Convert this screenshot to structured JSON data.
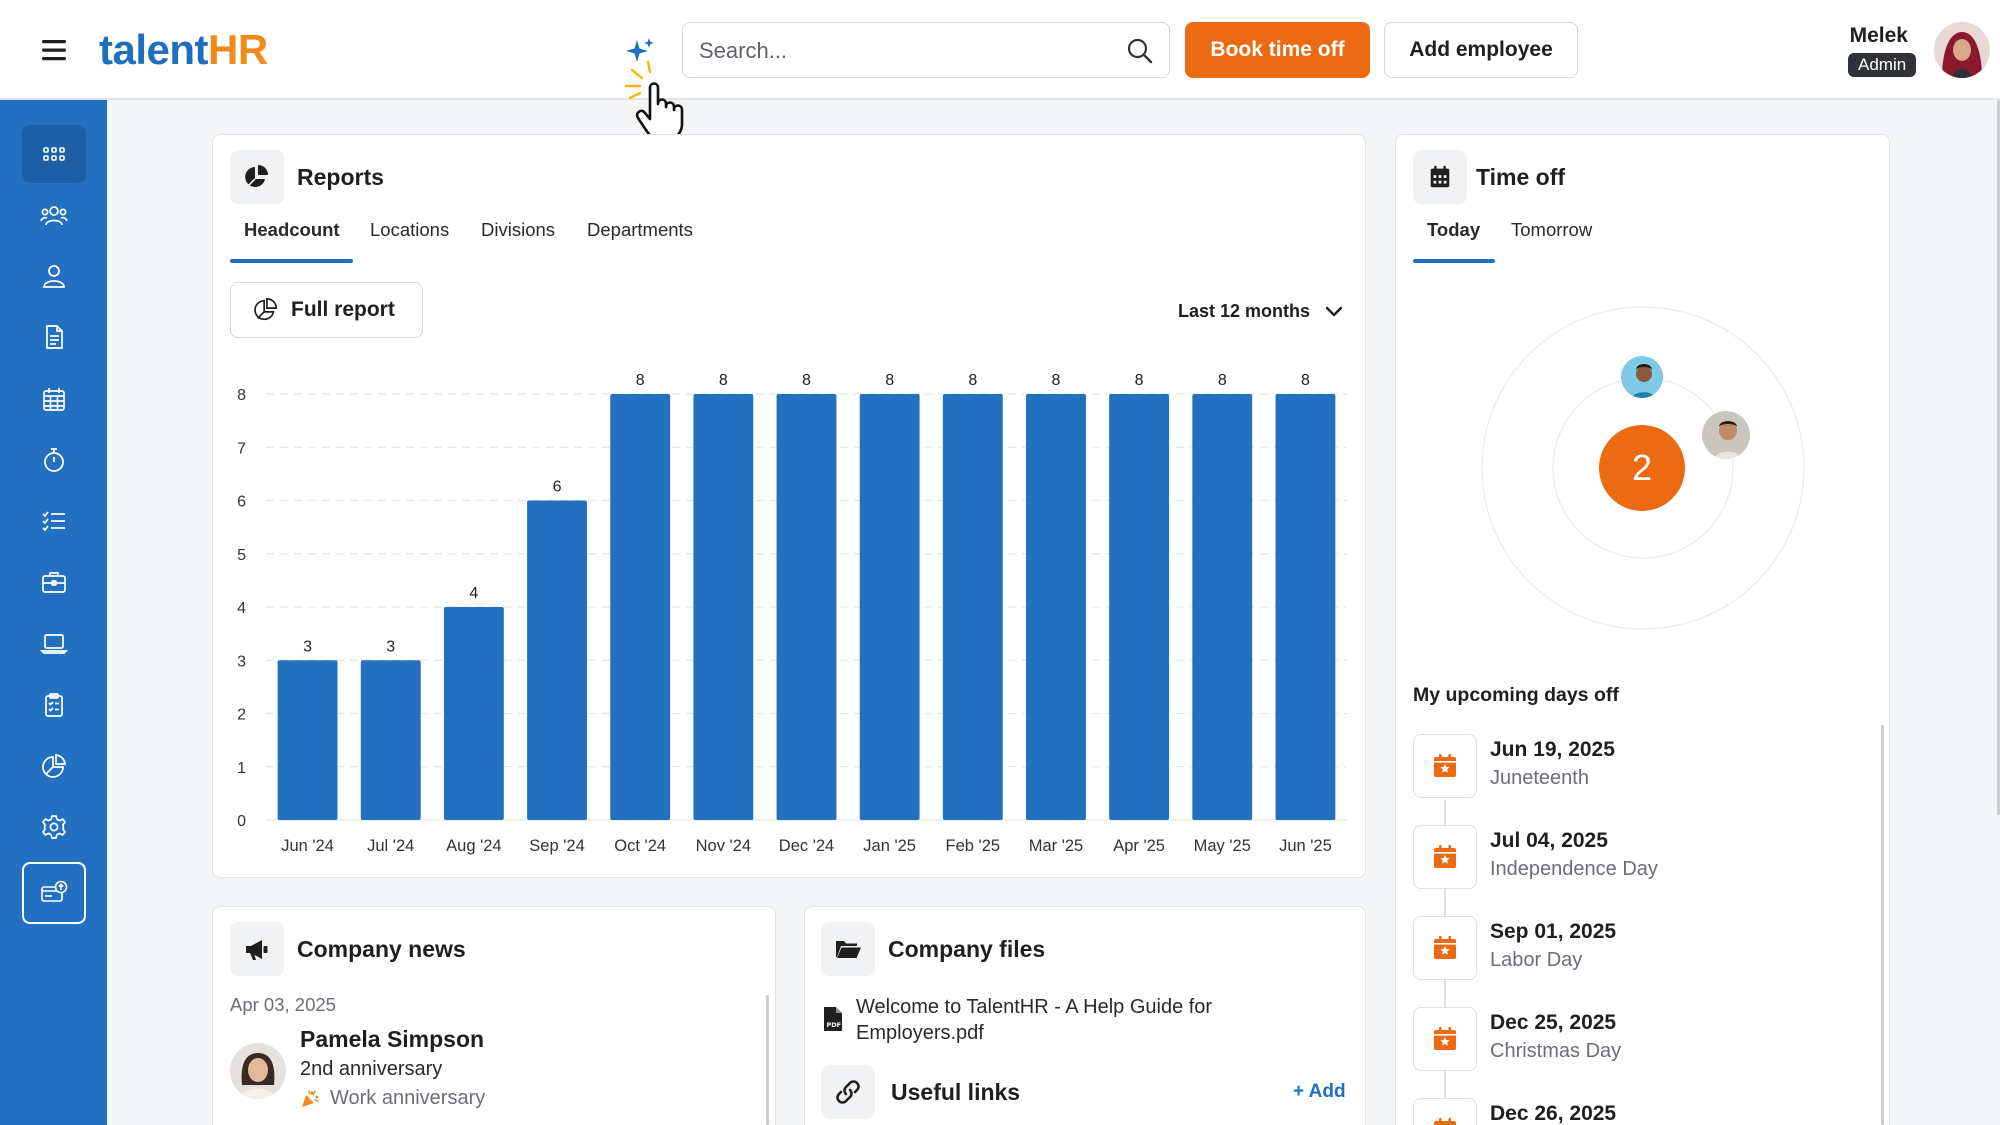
{
  "header": {
    "logo_part1": "talent",
    "logo_part2": "HR",
    "search_placeholder": "Search...",
    "book_time_off_label": "Book time off",
    "add_employee_label": "Add employee",
    "user_name": "Melek",
    "user_role": "Admin"
  },
  "sidebar": {
    "items": [
      {
        "name": "dashboard",
        "icon": "grid-icon",
        "active": true
      },
      {
        "name": "people",
        "icon": "group-icon"
      },
      {
        "name": "profile",
        "icon": "user-icon"
      },
      {
        "name": "documents",
        "icon": "document-icon"
      },
      {
        "name": "calendar",
        "icon": "calendar-icon"
      },
      {
        "name": "time-tracking",
        "icon": "stopwatch-icon"
      },
      {
        "name": "checklists",
        "icon": "checklist-icon"
      },
      {
        "name": "hiring",
        "icon": "briefcase-icon"
      },
      {
        "name": "assets",
        "icon": "laptop-icon"
      },
      {
        "name": "reviews",
        "icon": "clipboard-icon"
      },
      {
        "name": "reports",
        "icon": "pie-chart-icon"
      },
      {
        "name": "settings",
        "icon": "gear-icon"
      },
      {
        "name": "billing-upgrade",
        "icon": "card-upgrade-icon"
      }
    ]
  },
  "reports": {
    "title": "Reports",
    "tabs": [
      "Headcount",
      "Locations",
      "Divisions",
      "Departments"
    ],
    "active_tab": "Headcount",
    "full_report_label": "Full report",
    "range_label": "Last 12 months"
  },
  "chart_data": {
    "type": "bar",
    "title": "",
    "xlabel": "",
    "ylabel": "",
    "categories": [
      "Jun '24",
      "Jul '24",
      "Aug '24",
      "Sep '24",
      "Oct '24",
      "Nov '24",
      "Dec '24",
      "Jan '25",
      "Feb '25",
      "Mar '25",
      "Apr '25",
      "May '25",
      "Jun '25"
    ],
    "values": [
      3,
      3,
      4,
      6,
      8,
      8,
      8,
      8,
      8,
      8,
      8,
      8,
      8
    ],
    "ylim": [
      0,
      8
    ],
    "yticks": [
      0,
      1,
      2,
      3,
      4,
      5,
      6,
      7,
      8
    ],
    "grid": "horizontal dashed",
    "bar_color": "#2470c0",
    "data_labels": true
  },
  "time_off": {
    "title": "Time off",
    "tabs": [
      "Today",
      "Tomorrow"
    ],
    "active_tab": "Today",
    "count": "2",
    "upcoming_heading": "My upcoming days off",
    "days_off": [
      {
        "date": "Jun 19, 2025",
        "name": "Juneteenth"
      },
      {
        "date": "Jul 04, 2025",
        "name": "Independence Day"
      },
      {
        "date": "Sep 01, 2025",
        "name": "Labor Day"
      },
      {
        "date": "Dec 25, 2025",
        "name": "Christmas Day"
      },
      {
        "date": "Dec 26, 2025",
        "name": ""
      }
    ]
  },
  "company_news": {
    "title": "Company news",
    "date": "Apr 03, 2025",
    "person": "Pamela Simpson",
    "event": "2nd anniversary",
    "event_type": "Work anniversary"
  },
  "company_files": {
    "title": "Company files",
    "file_name": "Welcome to TalentHR - A Help Guide for Employers.pdf"
  },
  "useful_links": {
    "title": "Useful links",
    "add_label": "+ Add"
  },
  "colors": {
    "brand_blue": "#2470c0",
    "accent_orange": "#ec6a12",
    "logo_orange": "#f08a1c"
  }
}
